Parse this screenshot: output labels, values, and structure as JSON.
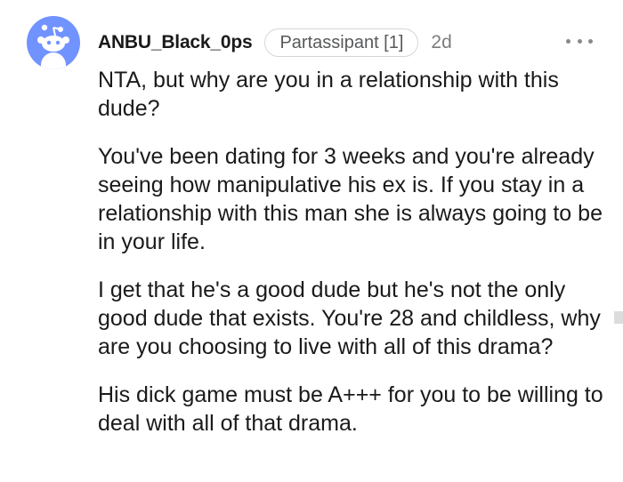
{
  "comment": {
    "username": "ANBU_Black_0ps",
    "flair": "Partassipant [1]",
    "age": "2d",
    "more_label": "More options",
    "paragraphs": [
      "NTA, but why are you in a relationship with this dude?",
      "You've been dating for 3 weeks and you're already seeing how manipulative his ex is. If you stay in a relationship with this man she is always going to be in your life.",
      "I get that he's a good dude but he's not the only good dude that exists. You're 28 and childless, why are you choosing to live with all of this drama?",
      "His dick game must be A+++ for you to be willing to deal with all of that drama."
    ]
  },
  "colors": {
    "avatar_bg": "#7193ff",
    "text": "#1a1a1b",
    "muted": "#7c7c7c",
    "flair_border": "#d4d6d9"
  },
  "icons": {
    "avatar": "snoo-avatar-icon",
    "more": "more-options-icon"
  }
}
